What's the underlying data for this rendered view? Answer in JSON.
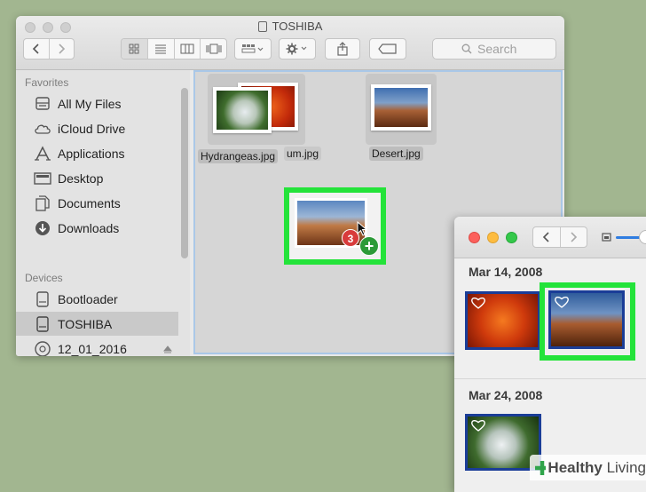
{
  "finder": {
    "title": "TOSHIBA",
    "search_placeholder": "Search",
    "sidebar": {
      "favorites_header": "Favorites",
      "favorites": [
        {
          "label": "All My Files",
          "icon": "all-files-icon"
        },
        {
          "label": "iCloud Drive",
          "icon": "cloud-icon"
        },
        {
          "label": "Applications",
          "icon": "applications-icon"
        },
        {
          "label": "Desktop",
          "icon": "desktop-icon"
        },
        {
          "label": "Documents",
          "icon": "documents-icon"
        },
        {
          "label": "Downloads",
          "icon": "downloads-icon"
        }
      ],
      "devices_header": "Devices",
      "devices": [
        {
          "label": "Bootloader",
          "icon": "drive-icon"
        },
        {
          "label": "TOSHIBA",
          "icon": "drive-icon",
          "selected": true
        },
        {
          "label": "12_01_2016",
          "icon": "disc-icon"
        }
      ]
    },
    "files": [
      {
        "name": "Hydrangeas.jpg"
      },
      {
        "name": "um.jpg"
      },
      {
        "name": "Desert.jpg"
      }
    ],
    "drag_count": "3"
  },
  "photos": {
    "groups": [
      {
        "date": "Mar 14, 2008"
      },
      {
        "date": "Mar 24, 2008"
      }
    ]
  },
  "watermark": {
    "brand_a": "Healthy",
    "brand_b": "Living"
  },
  "colors": {
    "highlight": "#24e33a",
    "selection_border": "#1a3d97",
    "desktop": "#a2b690"
  }
}
